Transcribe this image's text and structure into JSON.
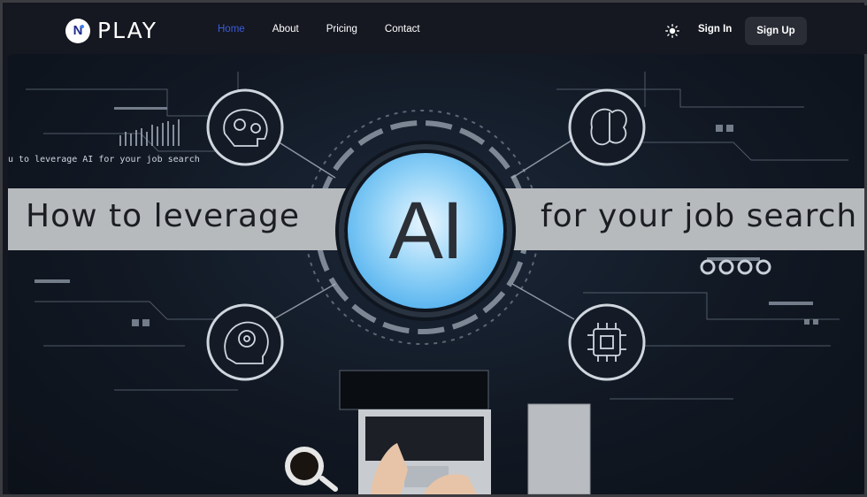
{
  "nav": {
    "brand": "PLAY",
    "brand_badge": "N",
    "links": [
      {
        "label": "Home",
        "active": true
      },
      {
        "label": "About",
        "active": false
      },
      {
        "label": "Pricing",
        "active": false
      },
      {
        "label": "Contact",
        "active": false
      }
    ],
    "theme_icon": "sun-icon",
    "signin_label": "Sign In",
    "signup_label": "Sign Up"
  },
  "hero": {
    "title_left": "How to leverage",
    "title_ai": "AI",
    "title_right": "for your job search",
    "caption": "u to leverage AI for your job search"
  },
  "colors": {
    "accent": "#3b5bdb",
    "nav_bg": "#151821",
    "band": "#b7babd",
    "ai_blue": "#2f9ee8"
  }
}
